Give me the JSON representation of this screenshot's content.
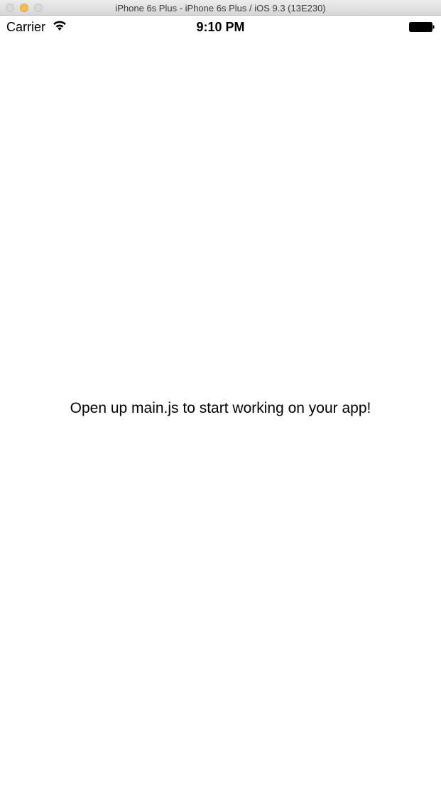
{
  "window": {
    "title": "iPhone 6s Plus - iPhone 6s Plus / iOS 9.3 (13E230)"
  },
  "status_bar": {
    "carrier": "Carrier",
    "time": "9:10 PM",
    "icons": [
      "wifi-icon",
      "battery-icon"
    ]
  },
  "main": {
    "message": "Open up main.js to start working on your app!"
  },
  "colors": {
    "titlebar": "#e3e3e3",
    "minimize_button": "#f5bd4f",
    "background": "#ffffff",
    "text": "#000000"
  }
}
